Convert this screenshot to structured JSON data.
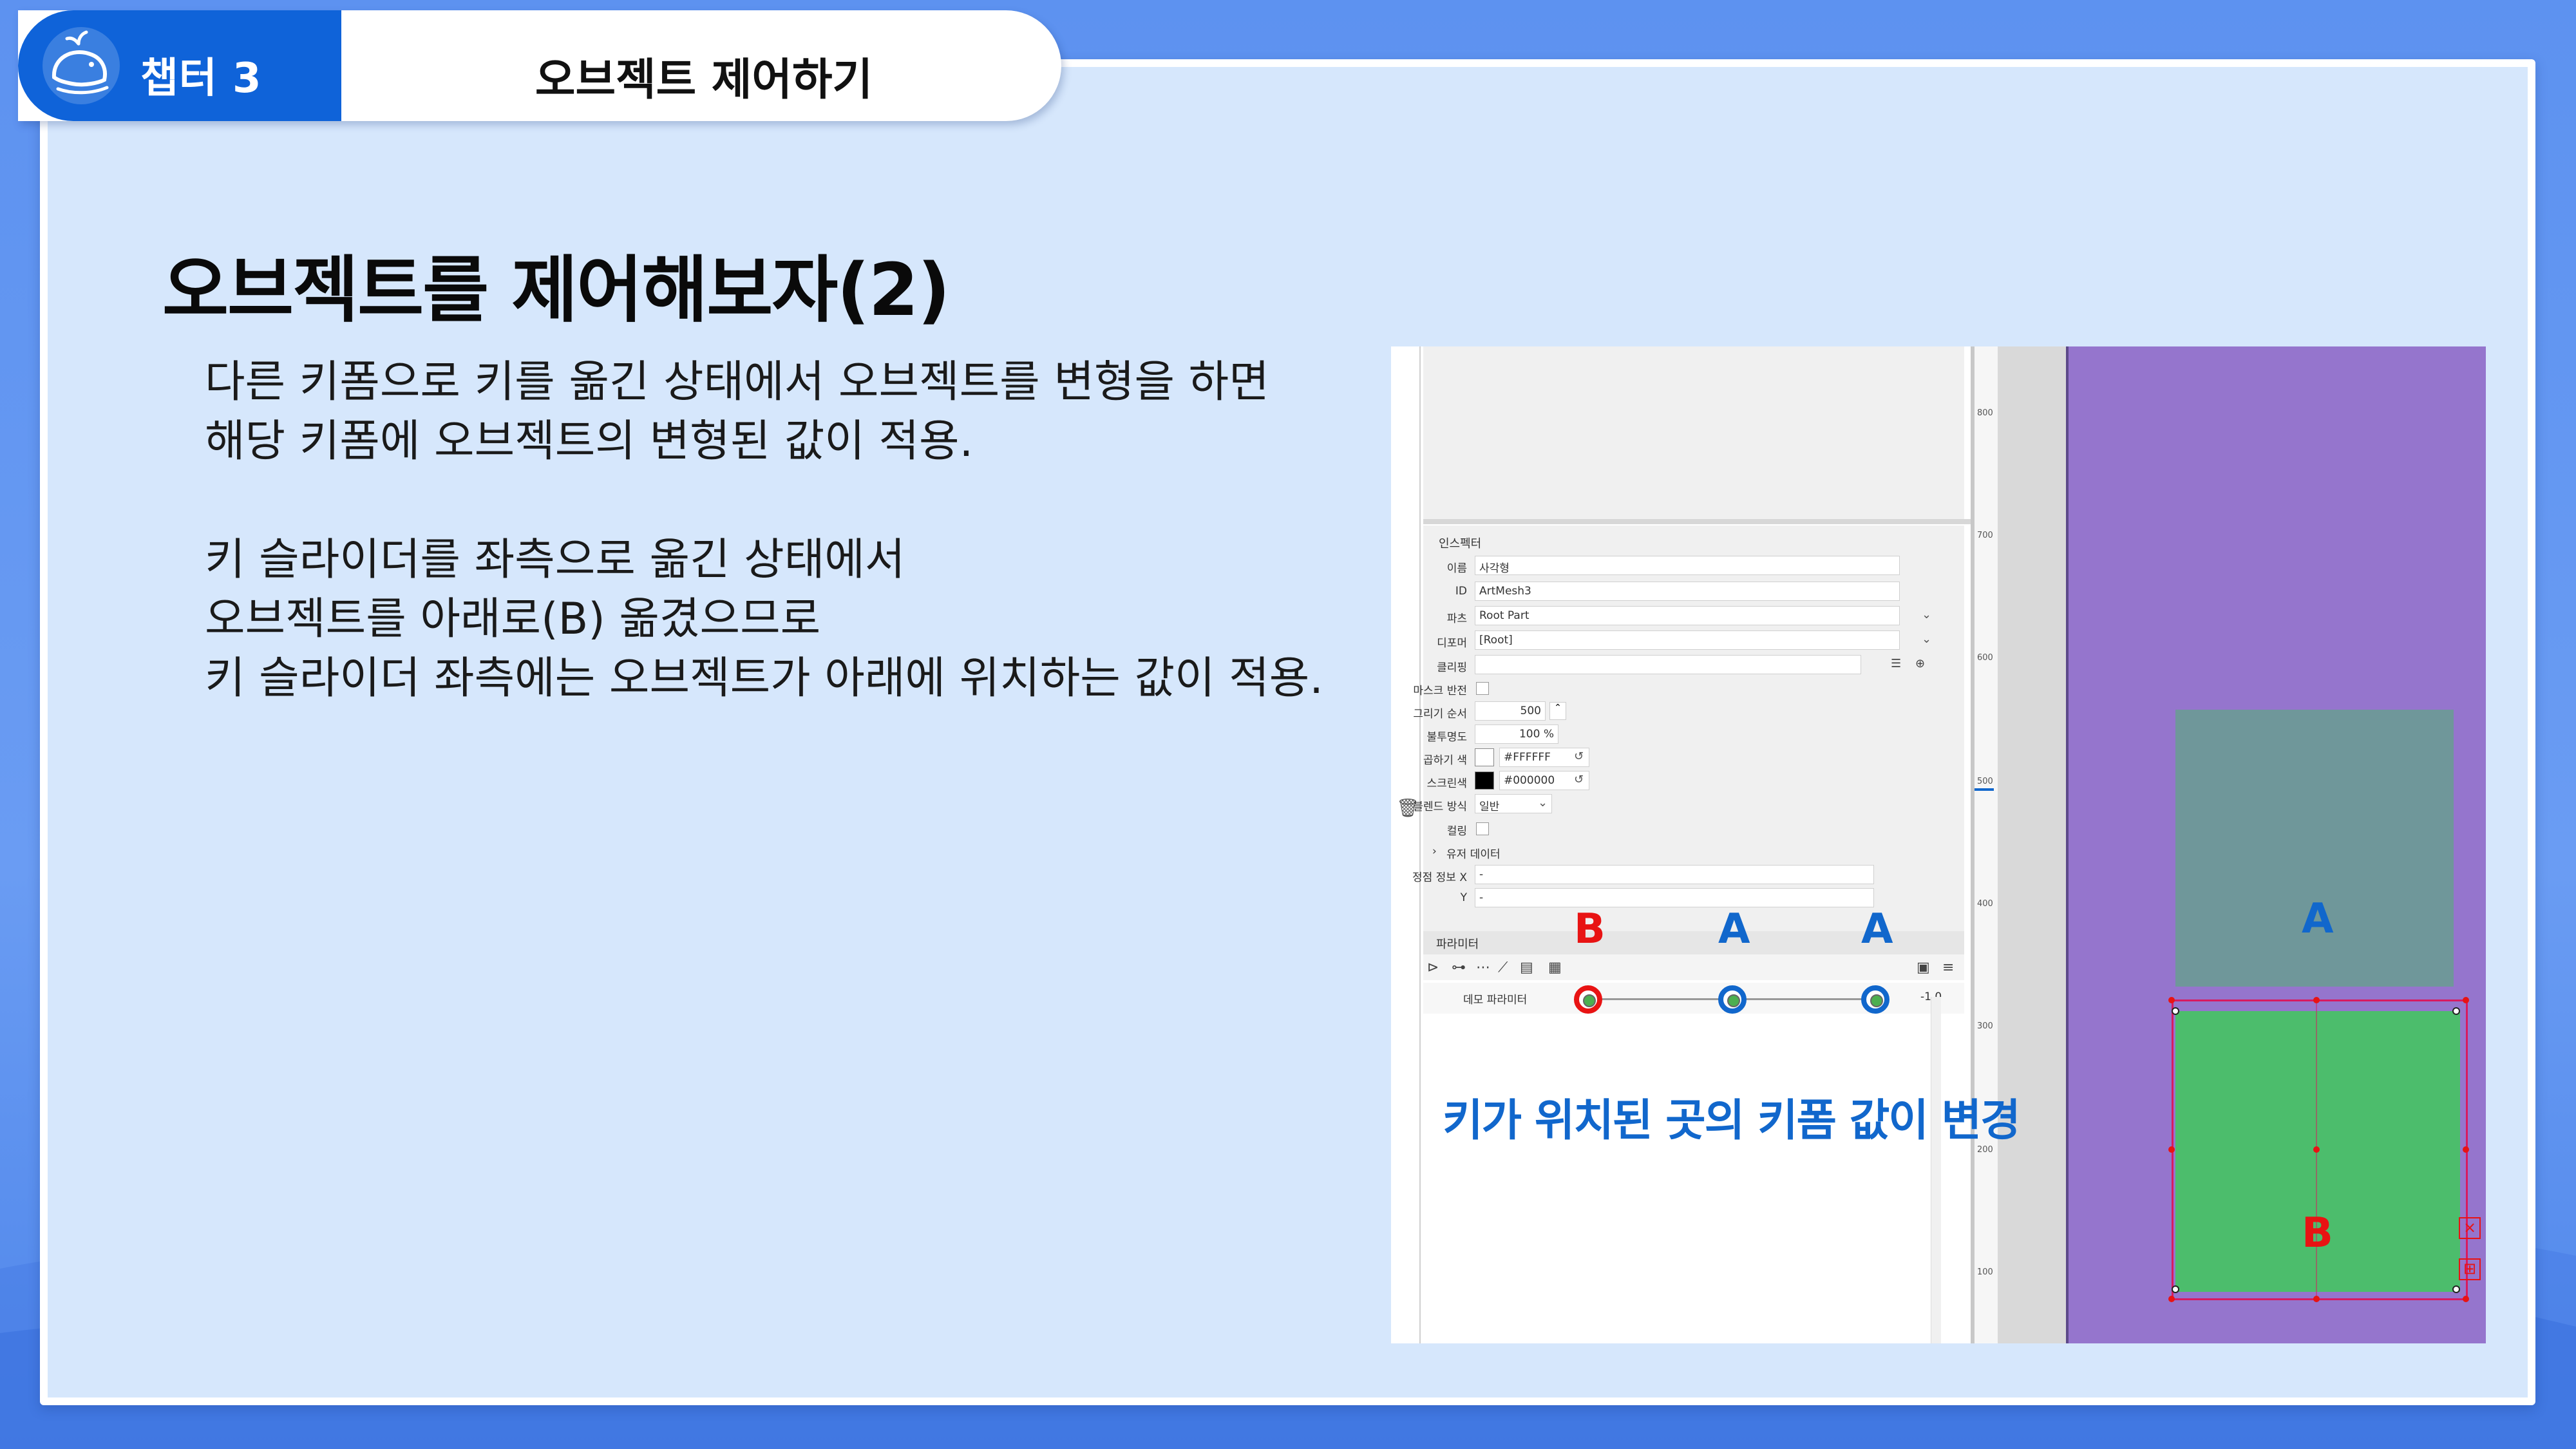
{
  "header": {
    "chapter": "챕터 3",
    "title": "오브젝트 제어하기"
  },
  "slide": {
    "heading": "오브젝트를 제어해보자(2)",
    "lines": [
      "다른 키폼으로 키를 옮긴 상태에서 오브젝트를 변형을 하면",
      "해당 키폼에 오브젝트의 변형된 값이 적용.",
      "",
      "키 슬라이더를 좌측으로 옮긴 상태에서",
      "오브젝트를 아래로(B) 옮겼으므로",
      "키 슬라이더 좌측에는 오브젝트가 아래에 위치하는 값이 적용."
    ]
  },
  "inspector": {
    "title": "인스펙터",
    "rows": [
      {
        "label": "이름",
        "value": "사각형"
      },
      {
        "label": "ID",
        "value": "ArtMesh3"
      },
      {
        "label": "파츠",
        "value": "Root Part"
      },
      {
        "label": "디포머",
        "value": "[Root]"
      },
      {
        "label": "클리핑",
        "value": ""
      },
      {
        "label": "마스크 반전",
        "value": ""
      },
      {
        "label": "그리기 순서",
        "value": "500"
      },
      {
        "label": "불투명도",
        "value": "100 %"
      },
      {
        "label": "곱하기 색",
        "value": "#FFFFFF"
      },
      {
        "label": "스크린색",
        "value": "#000000"
      },
      {
        "label": "블렌드 방식",
        "value": "일반"
      },
      {
        "label": "컬링",
        "value": ""
      },
      {
        "label": "유저 데이터",
        "value": ""
      },
      {
        "label": "정점 정보 X",
        "value": "-"
      },
      {
        "label": "Y",
        "value": "-"
      }
    ]
  },
  "parameter": {
    "title": "파라미터",
    "name": "데모 파라미터",
    "value": "-1.0",
    "labels": {
      "b": "B",
      "a1": "A",
      "a2": "A"
    }
  },
  "callout": "키가 위치된 곳의 키폼 값이 변경",
  "ruler": [
    "800",
    "700",
    "600",
    "500",
    "400",
    "300",
    "200",
    "100"
  ],
  "canvas": {
    "label_a": "A",
    "label_b": "B"
  },
  "colors": {
    "accent": "#1167cc",
    "red": "#e81313",
    "canvas": "#9575cd",
    "rectA": "#6f979a",
    "rectB": "#4cbd6c"
  }
}
